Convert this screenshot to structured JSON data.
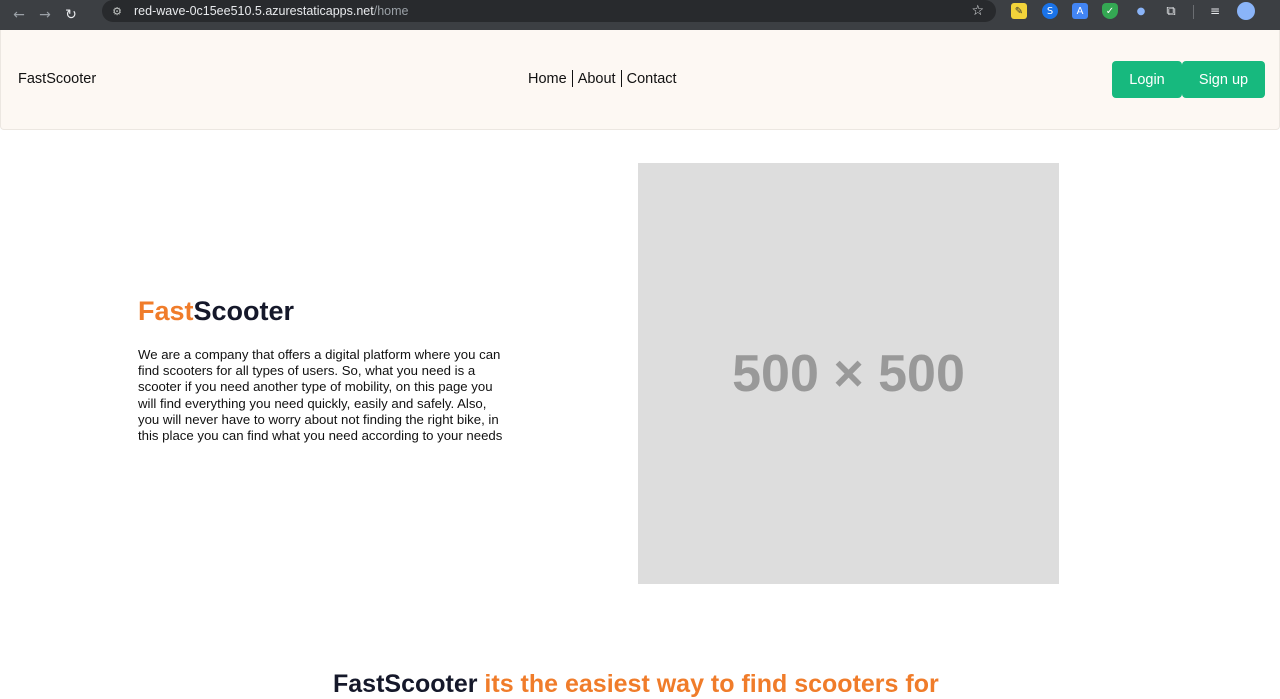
{
  "browser": {
    "url_host": "red-wave-0c15ee510.5.azurestaticapps.net",
    "url_path": "/home",
    "icons": [
      "back-arrow-icon",
      "forward-arrow-icon",
      "reload-icon",
      "site-settings-icon",
      "star-icon",
      "extension-icons",
      "reading-list-icon",
      "profile-avatar"
    ]
  },
  "navbar": {
    "brand": "FastScooter",
    "links": [
      "Home",
      "About",
      "Contact"
    ],
    "login_label": "Login",
    "signup_label": "Sign up"
  },
  "hero": {
    "title_accent": "Fast",
    "title_rest": "Scooter",
    "description": "We are a company that offers a digital platform where you can find scooters for all types of users. So, what you need is a scooter if you need another type of mobility, on this page you will find everything you need quickly, easily and safely. Also, you will never have to worry about not finding the right bike, in this place you can find what you need according to your needs",
    "image_placeholder": "500 × 500"
  },
  "tagline": {
    "lead": "FastScooter",
    "accent": " its the easiest way to find scooters for"
  },
  "colors": {
    "accent": "#f07c2a",
    "button": "#17b97e",
    "navbar_bg": "#fdf8f3"
  }
}
